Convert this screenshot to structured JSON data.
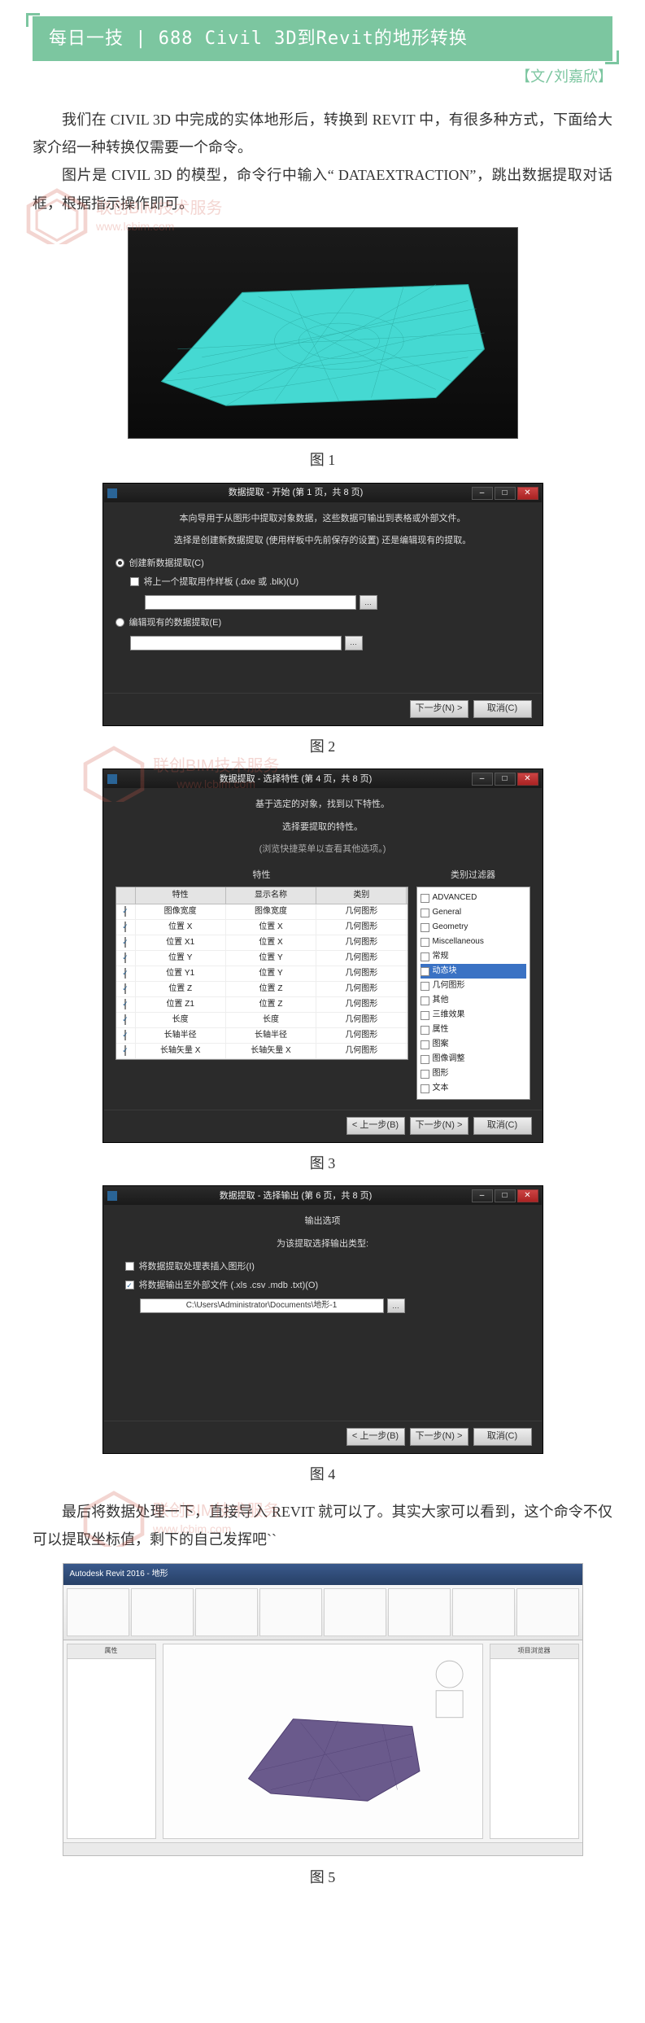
{
  "header": {
    "title": "每日一技 | 688 Civil 3D到Revit的地形转换",
    "author": "【文/刘嘉欣】"
  },
  "watermark": {
    "line1": "联创BIM技术服务",
    "line2": "www.lcbim.com"
  },
  "paras": {
    "p1": "我们在 CIVIL 3D 中完成的实体地形后，转换到 REVIT 中，有很多种方式，下面给大家介绍一种转换仅需要一个命令。",
    "p2": "图片是 CIVIL 3D 的模型，命令行中输入“ DATAEXTRACTION”，跳出数据提取对话框，根据指示操作即可。",
    "p3": "最后将数据处理一下，直接导入 REVIT 就可以了。其实大家可以看到，这个命令不仅可以提取坐标值，剩下的自己发挥吧``"
  },
  "captions": {
    "c1": "图 1",
    "c2": "图 2",
    "c3": "图 3",
    "c4": "图 4",
    "c5": "图 5"
  },
  "dlg2": {
    "title": "数据提取 - 开始 (第 1 页，共 8 页)",
    "intro": "本向导用于从图形中提取对象数据，这些数据可输出到表格或外部文件。",
    "q": "选择是创建新数据提取 (使用样板中先前保存的设置) 还是编辑现有的提取。",
    "r1": "创建新数据提取(C)",
    "chk1": "将上一个提取用作样板 (.dxe 或 .blk)(U)",
    "r2": "编辑现有的数据提取(E)",
    "next": "下一步(N) >",
    "cancel": "取消(C)"
  },
  "dlg3": {
    "title": "数据提取 - 选择特性 (第 4 页，共 8 页)",
    "intro1": "基于选定的对象，找到以下特性。",
    "intro2": "选择要提取的特性。",
    "intro3": "(浏览快捷菜单以查看其他选项。)",
    "grp_props": "特性",
    "grp_filter": "类别过滤器",
    "hdr_prop": "特性",
    "hdr_disp": "显示名称",
    "hdr_cat": "类别",
    "rows": [
      {
        "p": "图像宽度",
        "d": "图像宽度",
        "c": "几何图形"
      },
      {
        "p": "位置 X",
        "d": "位置 X",
        "c": "几何图形"
      },
      {
        "p": "位置 X1",
        "d": "位置 X",
        "c": "几何图形"
      },
      {
        "p": "位置 Y",
        "d": "位置 Y",
        "c": "几何图形"
      },
      {
        "p": "位置 Y1",
        "d": "位置 Y",
        "c": "几何图形"
      },
      {
        "p": "位置 Z",
        "d": "位置 Z",
        "c": "几何图形"
      },
      {
        "p": "位置 Z1",
        "d": "位置 Z",
        "c": "几何图形"
      },
      {
        "p": "长度",
        "d": "长度",
        "c": "几何图形"
      },
      {
        "p": "长轴半径",
        "d": "长轴半径",
        "c": "几何图形"
      },
      {
        "p": "长轴矢量 X",
        "d": "长轴矢量 X",
        "c": "几何图形"
      }
    ],
    "filters": [
      "ADVANCED",
      "General",
      "Geometry",
      "Miscellaneous",
      "常规",
      "动态块",
      "几何图形",
      "其他",
      "三维效果",
      "属性",
      "图案",
      "图像调整",
      "图形",
      "文本"
    ],
    "filter_selected": "动态块",
    "prev": "< 上一步(B)",
    "next": "下一步(N) >",
    "cancel": "取消(C)"
  },
  "dlg4": {
    "title": "数据提取 - 选择输出 (第 6 页，共 8 页)",
    "group": "输出选项",
    "lbl": "为该提取选择输出类型:",
    "chk1": "将数据提取处理表插入图形(I)",
    "chk2": "将数据输出至外部文件 (.xls .csv .mdb .txt)(O)",
    "path": "C:\\Users\\Administrator\\Documents\\地形-1",
    "prev": "< 上一步(B)",
    "next": "下一步(N) >",
    "cancel": "取消(C)"
  },
  "fig5": {
    "title": "Autodesk Revit 2016 - 地形"
  }
}
